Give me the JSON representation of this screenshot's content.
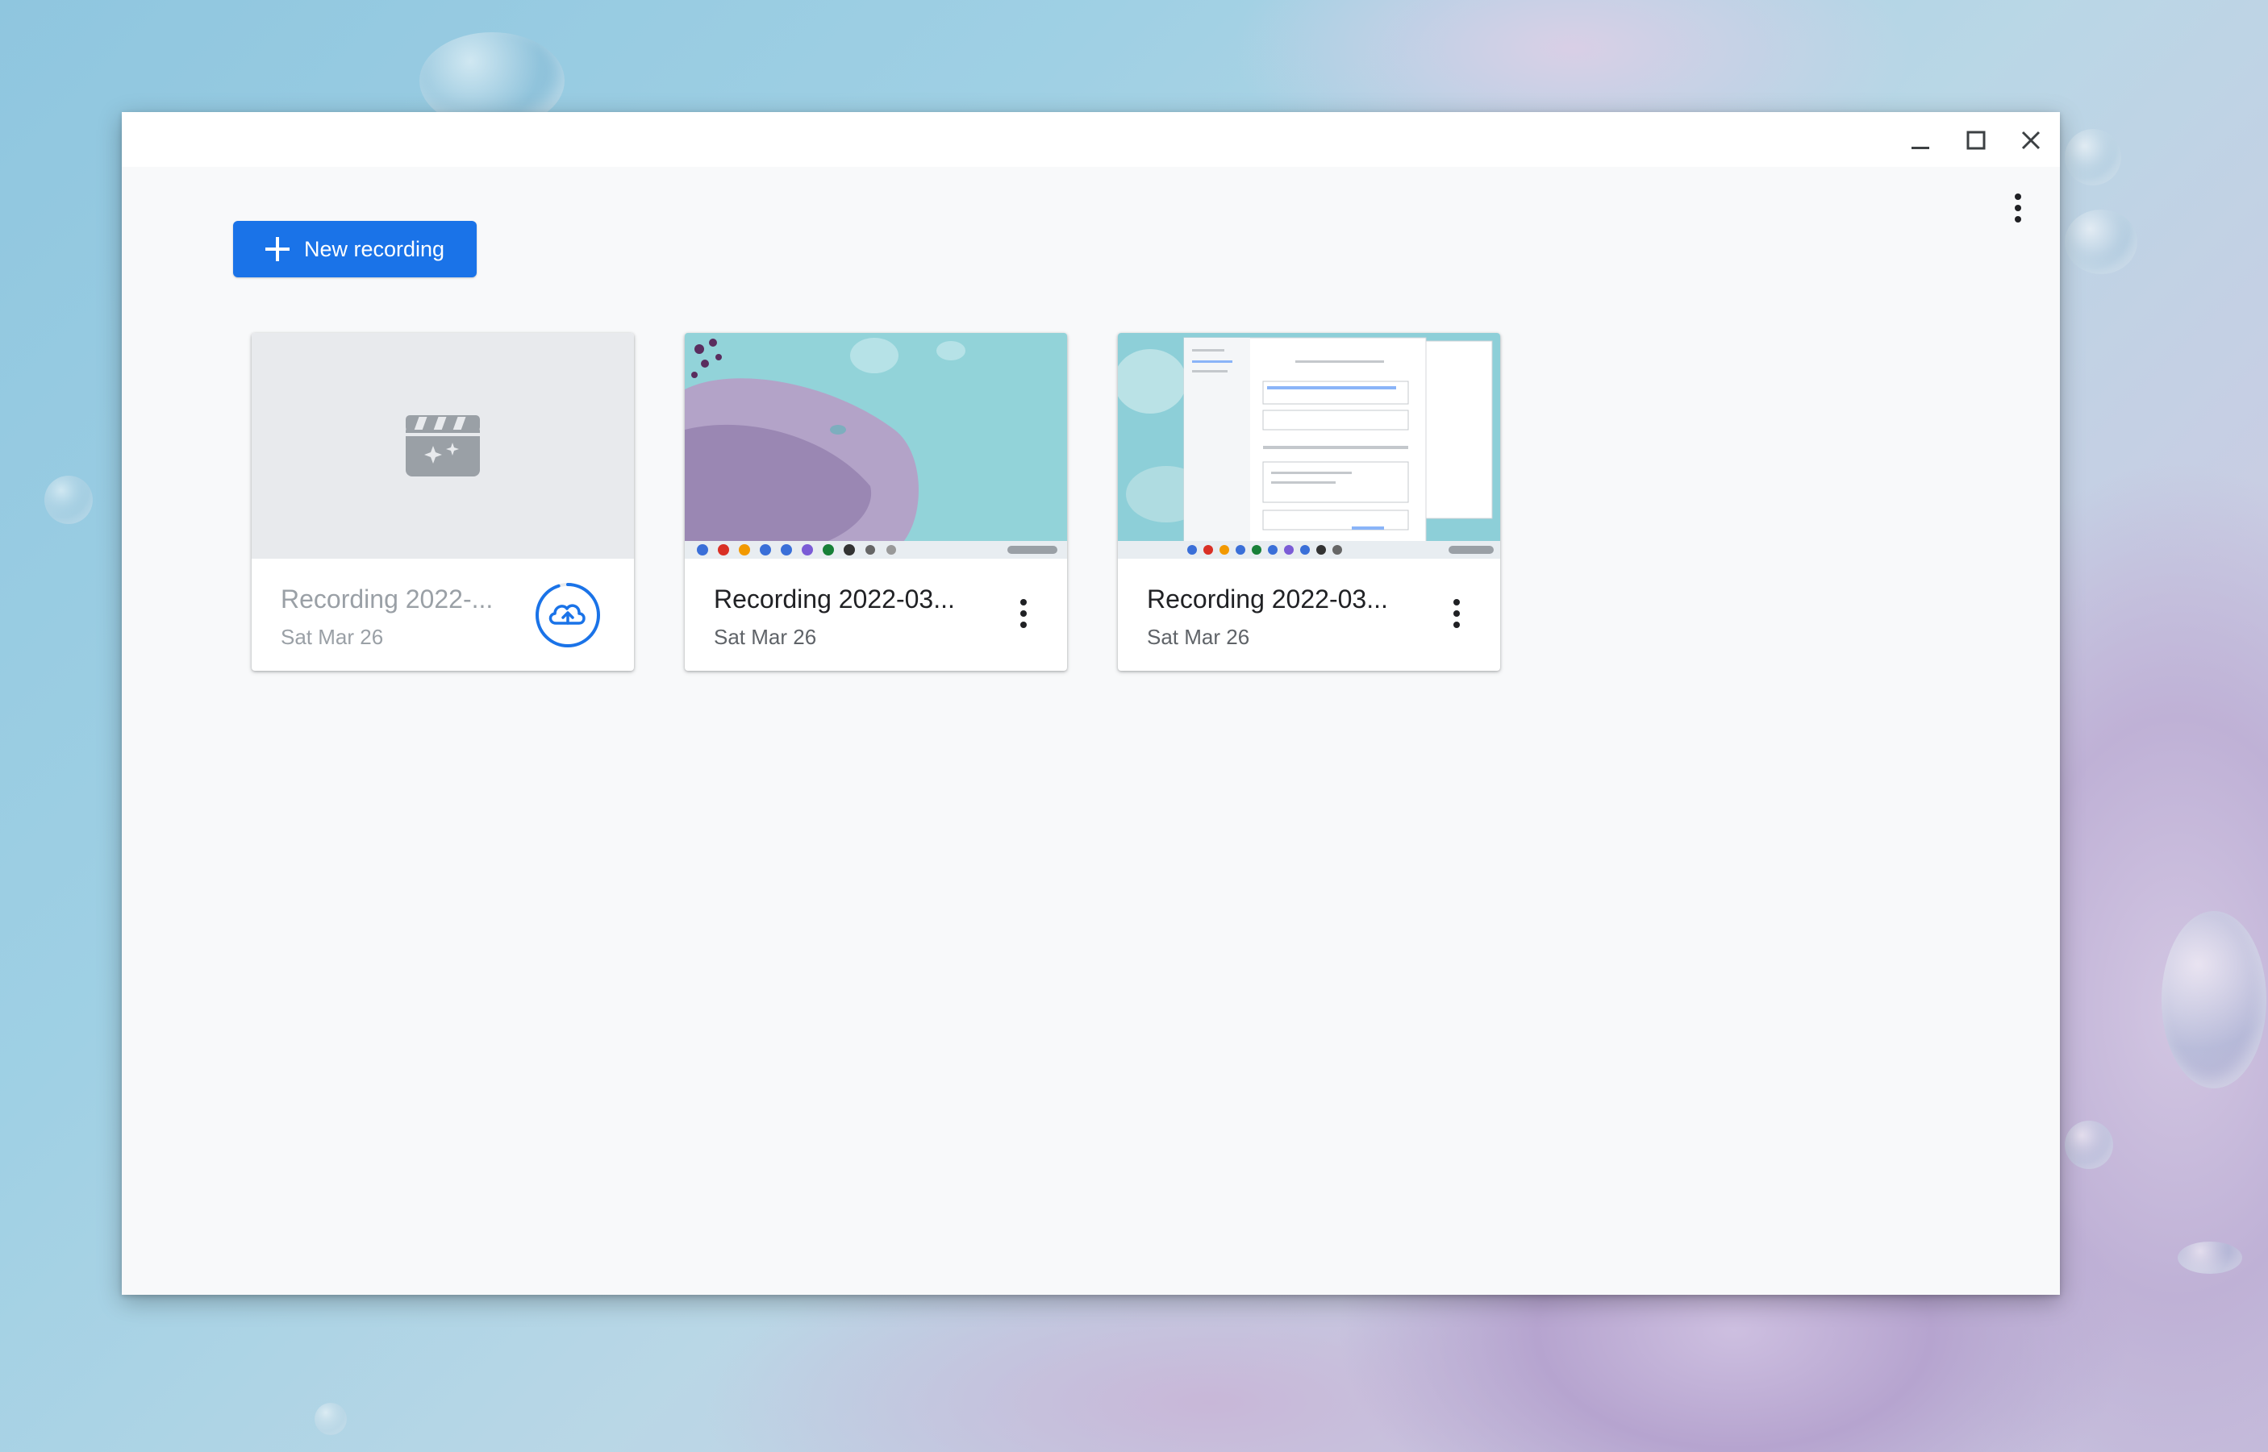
{
  "window": {
    "controls": {
      "minimize_icon": "minimize-icon",
      "maximize_icon": "maximize-icon",
      "close_icon": "close-icon"
    },
    "menu_icon": "more-vert-icon"
  },
  "toolbar": {
    "new_recording_label": "New recording",
    "new_recording_icon": "plus-icon"
  },
  "recordings": [
    {
      "title": "Recording 2022-...",
      "date": "Sat Mar 26",
      "state": "uploading",
      "thumbnail_icon": "movie-clapper-icon",
      "action_icon": "cloud-upload-icon",
      "upload_progress": 0.95
    },
    {
      "title": "Recording 2022-03...",
      "date": "Sat Mar 26",
      "state": "ready",
      "action_icon": "more-vert-icon"
    },
    {
      "title": "Recording 2022-03...",
      "date": "Sat Mar 26",
      "state": "ready",
      "action_icon": "more-vert-icon"
    }
  ],
  "colors": {
    "accent": "#1a73e8",
    "placeholder_bg": "#e8eaed",
    "placeholder_icon": "#9aa0a6"
  }
}
